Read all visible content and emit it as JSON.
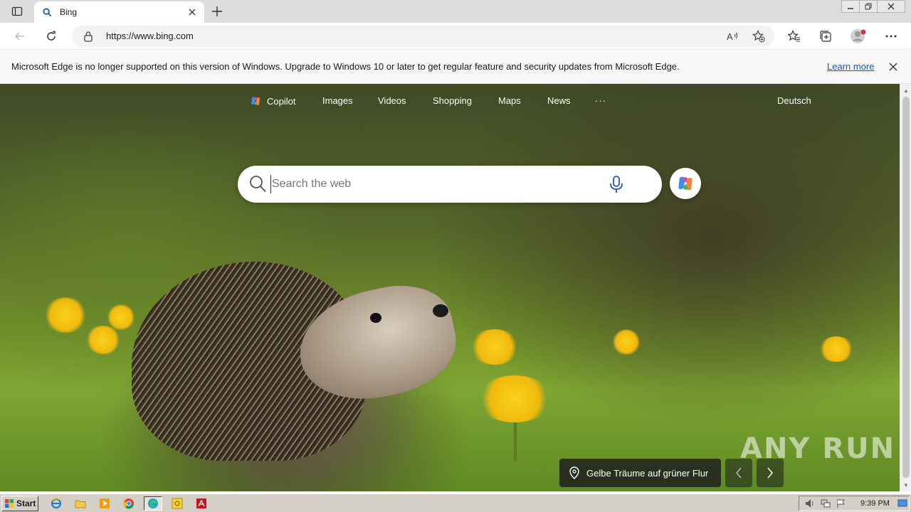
{
  "browser": {
    "tab_title": "Bing",
    "url": "https://www.bing.com"
  },
  "infobar": {
    "message": "Microsoft Edge is no longer supported on this version of Windows. Upgrade to Windows 10 or later to get regular feature and security updates from Microsoft Edge.",
    "learn_more": "Learn more"
  },
  "bing_nav": {
    "copilot": "Copilot",
    "images": "Images",
    "videos": "Videos",
    "shopping": "Shopping",
    "maps": "Maps",
    "news": "News",
    "more": "···",
    "language": "Deutsch"
  },
  "search": {
    "placeholder": "Search the web",
    "value": ""
  },
  "image_caption": "Gelbe Träume auf grüner Flur",
  "watermark": "ANY RUN",
  "taskbar": {
    "start": "Start",
    "clock": "9:39 PM"
  },
  "colors": {
    "link": "#0f5ab6",
    "taskbar": "#d4d0c8",
    "tab_strip": "#dcdcdc"
  }
}
